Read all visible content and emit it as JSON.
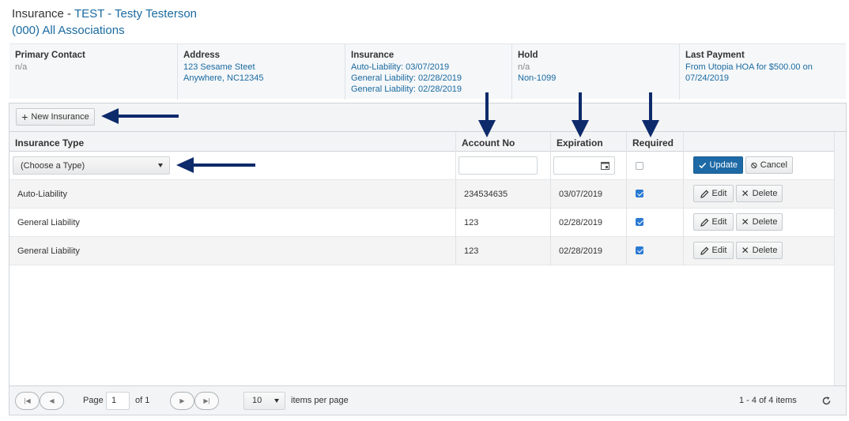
{
  "header": {
    "title_prefix": "Insurance - ",
    "title_link": "TEST - Testy Testerson",
    "subtitle": "(000) All Associations"
  },
  "info": {
    "primary_contact": {
      "heading": "Primary Contact",
      "value": "n/a"
    },
    "address": {
      "heading": "Address",
      "line1": "123 Sesame Steet",
      "line2": "Anywhere, NC12345"
    },
    "insurance": {
      "heading": "Insurance",
      "lines": [
        "Auto-Liability: 03/07/2019",
        "General Liability: 02/28/2019",
        "General Liability: 02/28/2019"
      ]
    },
    "hold": {
      "heading": "Hold",
      "line1": "n/a",
      "line2": "Non-1099"
    },
    "last_payment": {
      "heading": "Last Payment",
      "line1": "From Utopia HOA for $500.00 on",
      "line2": "07/24/2019"
    }
  },
  "toolbar": {
    "new_insurance_label": "New Insurance",
    "plus_icon": "plus-icon"
  },
  "table": {
    "columns": [
      "Insurance Type",
      "Account No",
      "Expiration",
      "Required",
      ""
    ],
    "edit_row": {
      "type_placeholder": "(Choose a Type)",
      "account_no": "",
      "expiration": "",
      "required": false,
      "update_label": "Update",
      "cancel_label": "Cancel"
    },
    "rows": [
      {
        "type": "Auto-Liability",
        "account_no": "234534635",
        "expiration": "03/07/2019",
        "required": true
      },
      {
        "type": "General Liability",
        "account_no": "123",
        "expiration": "02/28/2019",
        "required": true
      },
      {
        "type": "General Liability",
        "account_no": "123",
        "expiration": "02/28/2019",
        "required": true
      }
    ],
    "edit_label": "Edit",
    "delete_label": "Delete"
  },
  "pager": {
    "page_label": "Page",
    "page_value": "1",
    "of_label": "of 1",
    "page_size": "10",
    "items_per_page_label": "items per page",
    "summary": "1 - 4 of 4 items"
  },
  "colors": {
    "accent": "#1d6aa6",
    "link": "#1a6aa0",
    "annotation_arrow": "#0d2a6b"
  }
}
